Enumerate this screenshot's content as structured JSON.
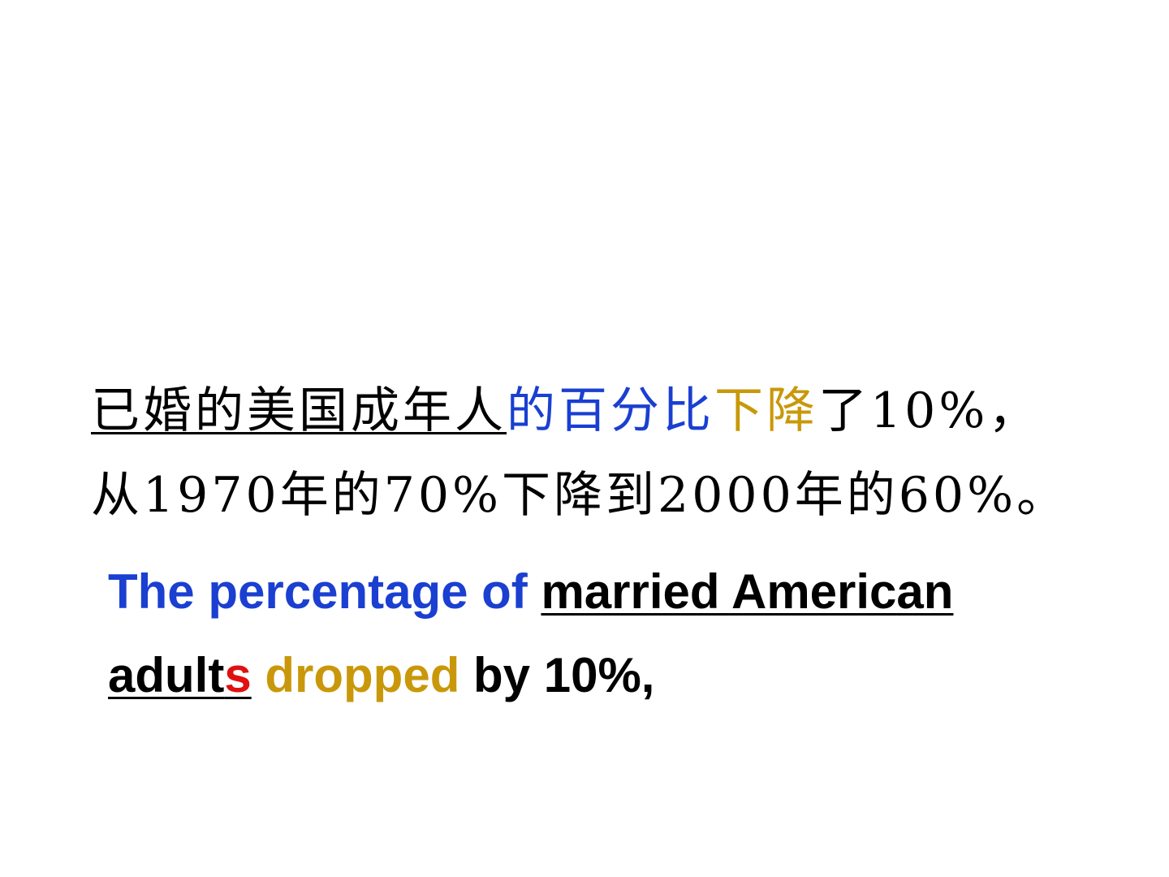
{
  "colors": {
    "black": "#000000",
    "blue": "#1a3fd1",
    "gold": "#c9980a",
    "red": "#e01010"
  },
  "chinese": {
    "line1": {
      "subject_underlined": "已婚的美国成年人",
      "percentage_blue": "的百分比",
      "dropped_gold": "下降",
      "rest": "了10%，"
    },
    "line2": "从1970年的70%下降到2000年的60%。"
  },
  "english": {
    "line1": {
      "the_percentage_of_blue": "The percentage of ",
      "married_american_underlined": "married American"
    },
    "line2": {
      "adult_underlined": "adult",
      "s_red_underlined": "s",
      "dropped_gold": " dropped",
      "rest": " by 10%,"
    }
  }
}
